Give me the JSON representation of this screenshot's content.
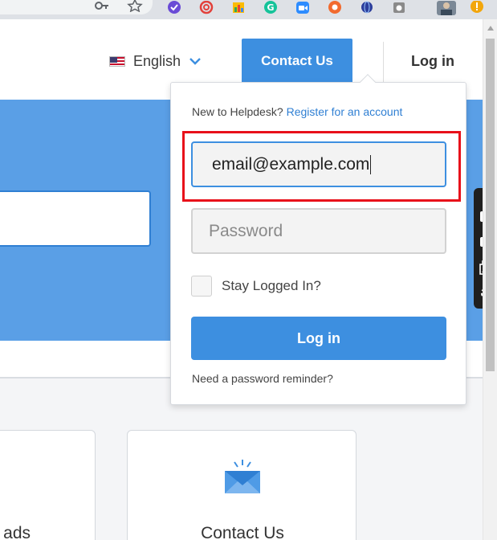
{
  "header": {
    "language_label": "English",
    "contact_label": "Contact Us",
    "login_label": "Log in"
  },
  "login_dropdown": {
    "new_prompt": "New to Helpdesk?",
    "register_link": "Register for an account",
    "email_value": "email@example.com",
    "password_placeholder": "Password",
    "stay_logged_label": "Stay Logged In?",
    "login_button": "Log in",
    "reminder_link": "Need a password reminder?"
  },
  "cards": {
    "downloads_title": "ads",
    "contact_title": "Contact Us"
  },
  "colors": {
    "accent": "#3d8fe0",
    "hero": "#5a9fe6",
    "highlight": "#e8101a"
  },
  "icons": {
    "language_dropdown": "chevron-down-icon",
    "contact_card": "envelope-icon"
  }
}
